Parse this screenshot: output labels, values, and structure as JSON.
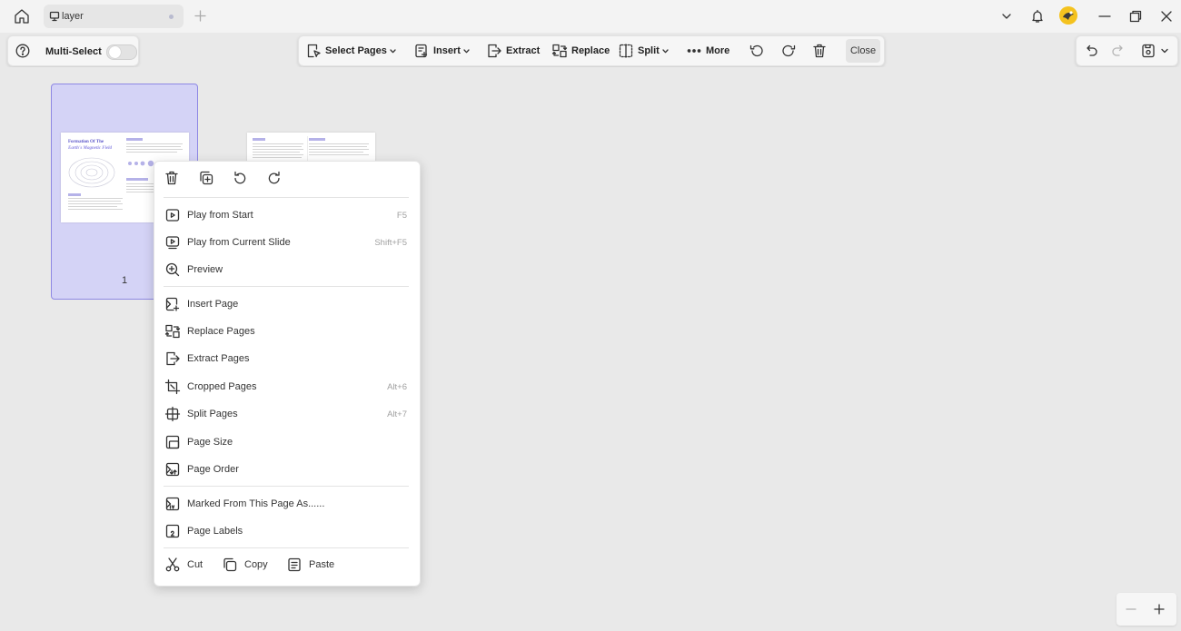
{
  "tab": {
    "title": "layer"
  },
  "left_toolbar": {
    "multi_select_label": "Multi-Select",
    "multi_select_on": false
  },
  "toolbar": {
    "select_pages": "Select Pages",
    "insert": "Insert",
    "extract": "Extract",
    "replace": "Replace",
    "split": "Split",
    "more": "More",
    "close": "Close"
  },
  "pages": [
    {
      "number": "1",
      "title_line1": "Formation Of The",
      "title_line2": "Earth's Magnetic Field"
    },
    {
      "number": ""
    }
  ],
  "context_menu": {
    "items": [
      {
        "label": "Play from Start",
        "shortcut": "F5"
      },
      {
        "label": "Play from Current Slide",
        "shortcut": "Shift+F5"
      },
      {
        "label": "Preview",
        "shortcut": ""
      },
      {
        "label": "Insert Page",
        "shortcut": ""
      },
      {
        "label": "Replace Pages",
        "shortcut": ""
      },
      {
        "label": "Extract Pages",
        "shortcut": ""
      },
      {
        "label": "Cropped Pages",
        "shortcut": "Alt+6"
      },
      {
        "label": "Split Pages",
        "shortcut": "Alt+7"
      },
      {
        "label": "Page Size",
        "shortcut": ""
      },
      {
        "label": "Page Order",
        "shortcut": ""
      },
      {
        "label": "Marked From This Page As......",
        "shortcut": ""
      },
      {
        "label": "Page Labels",
        "shortcut": ""
      }
    ],
    "cut": "Cut",
    "copy": "Copy",
    "paste": "Paste"
  },
  "colors": {
    "selection_fill": "#d4d3f6",
    "selection_border": "#8e88e4",
    "thumb_accent": "#5b56c9"
  }
}
